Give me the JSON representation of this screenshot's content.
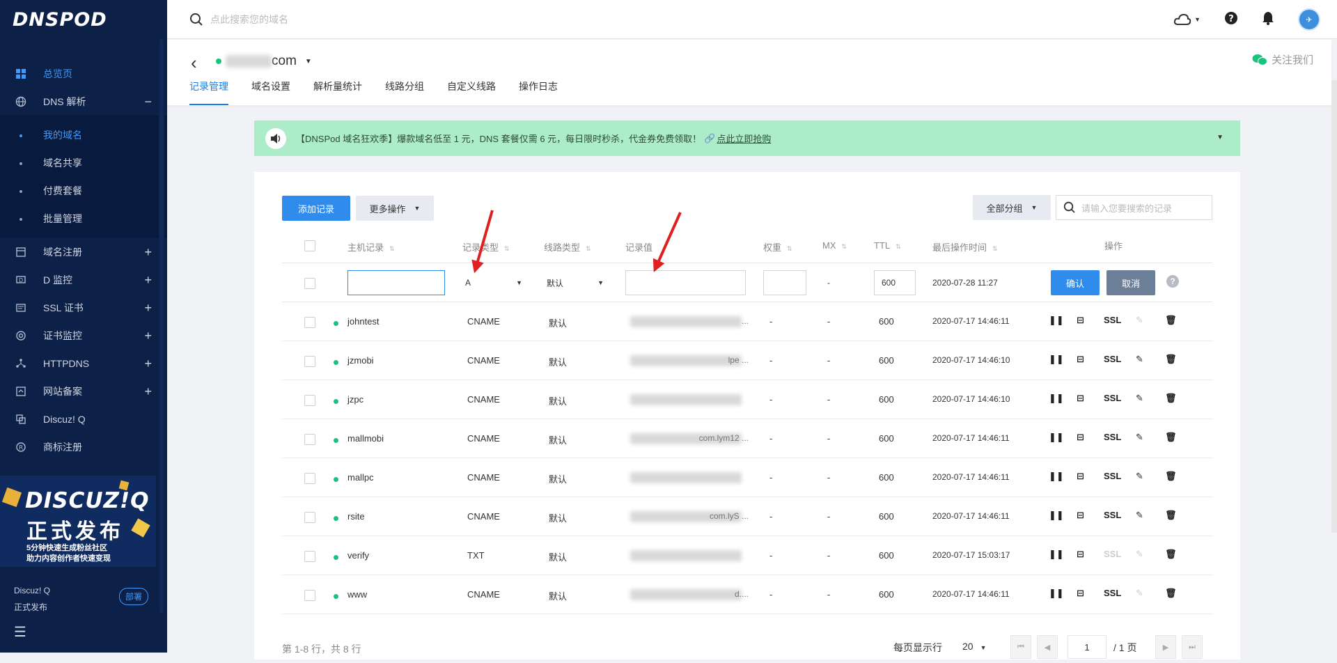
{
  "sidebar": {
    "logo": "DNSPOD",
    "items": [
      {
        "label": "总览页",
        "icon": "grid-icon",
        "active": true
      },
      {
        "label": "DNS 解析",
        "icon": "globe-icon",
        "expand": "−"
      }
    ],
    "sub_items": [
      "我的域名",
      "域名共享",
      "付费套餐",
      "批量管理"
    ],
    "items2": [
      {
        "label": "域名注册",
        "icon": "calendar-icon",
        "expand": "+"
      },
      {
        "label": "D 监控",
        "icon": "monitor-icon",
        "expand": "+"
      },
      {
        "label": "SSL 证书",
        "icon": "certificate-icon",
        "expand": "+"
      },
      {
        "label": "证书监控",
        "icon": "eye-icon",
        "expand": "+"
      },
      {
        "label": "HTTPDNS",
        "icon": "nodes-icon",
        "expand": "+"
      },
      {
        "label": "网站备案",
        "icon": "filing-icon",
        "expand": "+"
      },
      {
        "label": "Discuz! Q",
        "icon": "copy-icon"
      },
      {
        "label": "商标注册",
        "icon": "registered-icon"
      }
    ],
    "banner": {
      "line1": "DISCUZ!Q",
      "line2": "正式发布",
      "line3": "5分钟快速生成粉丝社区",
      "line4": "助力内容创作者快速变现"
    },
    "promo_title": "Discuz! Q",
    "promo_sub": "正式发布",
    "deploy_label": "部署",
    "collapse": "☰"
  },
  "topbar": {
    "search_placeholder": "点此搜索您的域名"
  },
  "domain": {
    "name_suffix": "com",
    "caret": "▼",
    "follow": "关注我们",
    "tabs": [
      "记录管理",
      "域名设置",
      "解析量统计",
      "线路分组",
      "自定义线路",
      "操作日志"
    ]
  },
  "notice": {
    "text": "【DNSPod 域名狂欢季】爆款域名低至 1 元，DNS 套餐仅需 6 元，每日限时秒杀，代金券免费领取！",
    "link": "点此立即抢购",
    "caret": "▼"
  },
  "toolbar": {
    "add": "添加记录",
    "more": "更多操作",
    "group": "全部分组",
    "search_placeholder": "请输入您要搜索的记录"
  },
  "table": {
    "headers": {
      "host": "主机记录",
      "type": "记录类型",
      "line": "线路类型",
      "value": "记录值",
      "weight": "权重",
      "mx": "MX",
      "ttl": "TTL",
      "time": "最后操作时间",
      "ops": "操作"
    },
    "edit": {
      "type": "A",
      "line": "默认",
      "weight_placeholder": "",
      "mx": "-",
      "ttl": "600",
      "time": "2020-07-28 11:27",
      "confirm": "确认",
      "cancel": "取消",
      "help": "?"
    },
    "rows": [
      {
        "host": "johntest",
        "type": "CNAME",
        "line": "默认",
        "value_tail": "...",
        "weight": "-",
        "mx": "-",
        "ttl": "600",
        "time": "2020-07-17 14:46:11",
        "ssl_enabled": true,
        "edit_enabled": false
      },
      {
        "host": "jzmobi",
        "type": "CNAME",
        "line": "默认",
        "value_tail": "lpe ...",
        "weight": "-",
        "mx": "-",
        "ttl": "600",
        "time": "2020-07-17 14:46:10",
        "ssl_enabled": true,
        "edit_enabled": true
      },
      {
        "host": "jzpc",
        "type": "CNAME",
        "line": "默认",
        "value_tail": "",
        "weight": "-",
        "mx": "-",
        "ttl": "600",
        "time": "2020-07-17 14:46:10",
        "ssl_enabled": true,
        "edit_enabled": true
      },
      {
        "host": "mallmobi",
        "type": "CNAME",
        "line": "默认",
        "value_tail": "com.lym12 ...",
        "weight": "-",
        "mx": "-",
        "ttl": "600",
        "time": "2020-07-17 14:46:11",
        "ssl_enabled": true,
        "edit_enabled": true
      },
      {
        "host": "mallpc",
        "type": "CNAME",
        "line": "默认",
        "value_tail": "",
        "weight": "-",
        "mx": "-",
        "ttl": "600",
        "time": "2020-07-17 14:46:11",
        "ssl_enabled": true,
        "edit_enabled": true
      },
      {
        "host": "rsite",
        "type": "CNAME",
        "line": "默认",
        "value_tail": "com.lyS ...",
        "weight": "-",
        "mx": "-",
        "ttl": "600",
        "time": "2020-07-17 14:46:11",
        "ssl_enabled": true,
        "edit_enabled": true
      },
      {
        "host": "verify",
        "type": "TXT",
        "line": "默认",
        "value_tail": "",
        "weight": "-",
        "mx": "-",
        "ttl": "600",
        "time": "2020-07-17 15:03:17",
        "ssl_enabled": false,
        "edit_enabled": false
      },
      {
        "host": "www",
        "type": "CNAME",
        "line": "默认",
        "value_tail": "d....",
        "weight": "-",
        "mx": "-",
        "ttl": "600",
        "time": "2020-07-17 14:46:11",
        "ssl_enabled": true,
        "edit_enabled": false
      }
    ],
    "ssl_label": "SSL"
  },
  "pager": {
    "summary": "第 1-8 行，共 8 行",
    "per_page_label": "每页显示行",
    "per_page": "20",
    "page": "1",
    "total": "/ 1 页"
  }
}
